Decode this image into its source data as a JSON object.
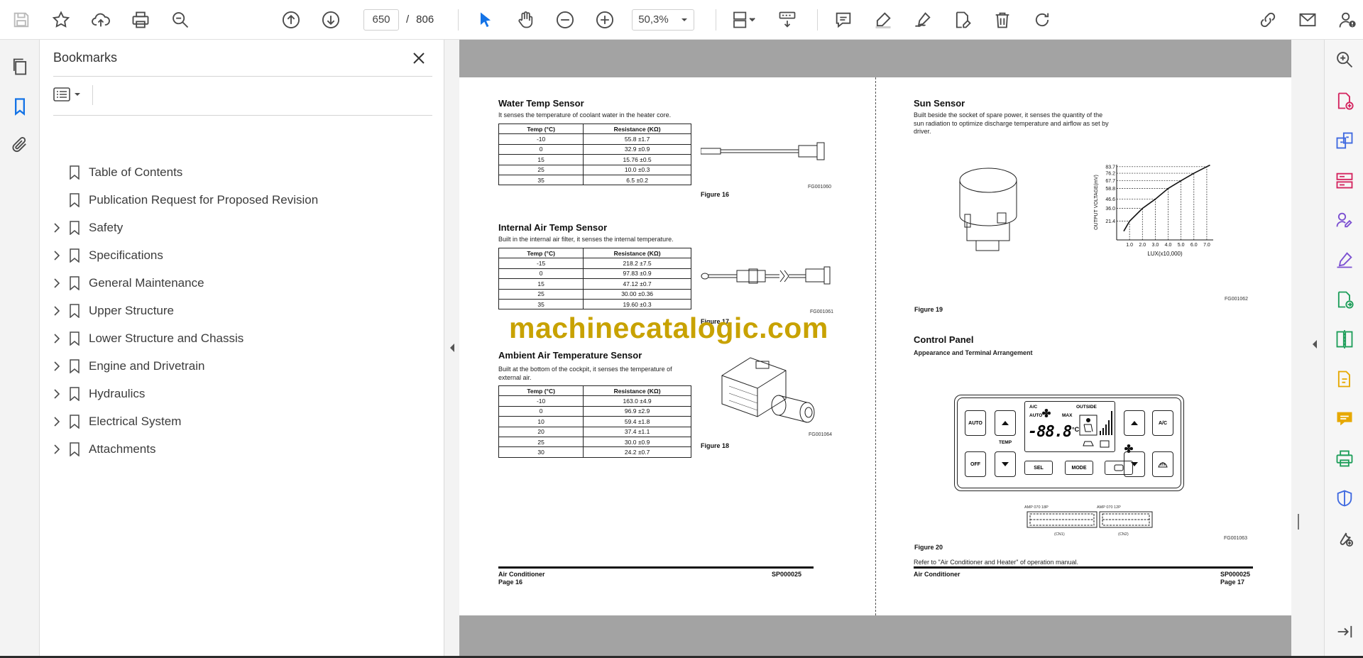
{
  "toolbar": {
    "page_current": "650",
    "page_separator": "/",
    "page_total": "806",
    "zoom": "50,3%"
  },
  "bookmarks": {
    "title": "Bookmarks",
    "items": [
      {
        "label": "Table of Contents",
        "expandable": false
      },
      {
        "label": "Publication Request for Proposed Revision",
        "expandable": false
      },
      {
        "label": "Safety",
        "expandable": true
      },
      {
        "label": "Specifications",
        "expandable": true
      },
      {
        "label": "General Maintenance",
        "expandable": true
      },
      {
        "label": "Upper Structure",
        "expandable": true
      },
      {
        "label": "Lower Structure and Chassis",
        "expandable": true
      },
      {
        "label": "Engine and Drivetrain",
        "expandable": true
      },
      {
        "label": "Hydraulics",
        "expandable": true
      },
      {
        "label": "Electrical System",
        "expandable": true
      },
      {
        "label": "Attachments",
        "expandable": true
      }
    ]
  },
  "colors": {
    "accent": "#1473e6",
    "icon": "#4b4b4b",
    "tool_pink": "#d4245f",
    "tool_blue": "#3f69e0",
    "tool_purple": "#7b4fd1",
    "tool_green": "#1e9e5a",
    "tool_yellow": "#e6a800",
    "watermark": "#c8a200"
  },
  "page16": {
    "water": {
      "heading": "Water Temp Sensor",
      "desc": "It senses the temperature of coolant water in the heater core.",
      "col1": "Temp (°C)",
      "col2": "Resistance (KΩ)",
      "rows": [
        [
          "-10",
          "55.8 ±1.7"
        ],
        [
          "0",
          "32.9 ±0.9"
        ],
        [
          "15",
          "15.76 ±0.5"
        ],
        [
          "25",
          "10.0 ±0.3"
        ],
        [
          "35",
          "6.5 ±0.2"
        ]
      ],
      "code": "FG001060",
      "figure": "Figure 16"
    },
    "internal": {
      "heading": "Internal Air Temp Sensor",
      "desc": "Built in the internal air filter, it senses the internal temperature.",
      "col1": "Temp (°C)",
      "col2": "Resistance (KΩ)",
      "rows": [
        [
          "-15",
          "218.2 ±7.5"
        ],
        [
          "0",
          "97.83 ±0.9"
        ],
        [
          "15",
          "47.12 ±0.7"
        ],
        [
          "25",
          "30.00 ±0.36"
        ],
        [
          "35",
          "19.60 ±0.3"
        ]
      ],
      "code": "FG001061",
      "figure": "Figure 17"
    },
    "ambient": {
      "heading": "Ambient Air Temperature Sensor",
      "desc": "Built at the bottom of the cockpit, it senses the temperature of external air.",
      "col1": "Temp (°C)",
      "col2": "Resistance (KΩ)",
      "rows": [
        [
          "-10",
          "163.0 ±4.9"
        ],
        [
          "0",
          "96.9 ±2.9"
        ],
        [
          "10",
          "59.4 ±1.8"
        ],
        [
          "20",
          "37.4 ±1.1"
        ],
        [
          "25",
          "30.0 ±0.9"
        ],
        [
          "30",
          "24.2 ±0.7"
        ]
      ],
      "code": "FG001064",
      "figure": "Figure 18"
    },
    "footer_left": "Air Conditioner",
    "footer_page": "Page 16",
    "footer_right": "SP000025"
  },
  "page17": {
    "sun": {
      "heading": "Sun Sensor",
      "desc": "Built beside the socket of spare power, it senses the quantity of the sun radiation to optimize discharge temperature and airflow as set by driver.",
      "figure": "Figure 19",
      "code": "FG001062"
    },
    "control": {
      "heading": "Control Panel",
      "subheading": "Appearance and Terminal Arrangement",
      "figure": "Figure 20",
      "code": "FG001063",
      "note": "Refer to \"Air Conditioner and Heater\" of operation manual.",
      "panel": {
        "auto_btn": "AUTO",
        "off_btn": "OFF",
        "ac_btn": "A/C",
        "temp_label": "TEMP",
        "sel_btn": "SEL",
        "mode_btn": "MODE",
        "lcd_ac": "A/C",
        "lcd_auto": "AUTO",
        "lcd_max": "MAX",
        "lcd_outside": "OUTSIDE",
        "lcd_digits": "-88.8",
        "lcd_unit": "°C"
      },
      "connector1": "AMP 070 18P",
      "connector2": "AMP 070 12P",
      "cn1": "(CN1)",
      "cn2": "(CN2)"
    },
    "footer_left": "Air Conditioner",
    "footer_page": "Page 17",
    "footer_right": "SP000025"
  },
  "watermark": "machinecatalogic.com",
  "chart_data": {
    "type": "line",
    "title": "",
    "xlabel": "LUX(x10,000)",
    "ylabel": "OUTPUT VOLTAGE(mV)",
    "x": [
      1.0,
      2.0,
      3.0,
      4.0,
      5.0,
      6.0,
      7.0
    ],
    "x_ticks": [
      "1.0",
      "2.0",
      "3.0",
      "4.0",
      "5.0",
      "6.0",
      "7.0"
    ],
    "y_ticks": [
      "21.4",
      "36.0",
      "46.6",
      "58.8",
      "67.7",
      "76.2",
      "83.7"
    ],
    "series": [
      {
        "values": [
          21.4,
          36.0,
          46.6,
          58.8,
          67.7,
          76.2,
          83.7
        ]
      }
    ],
    "xlim": [
      0,
      7.5
    ],
    "ylim": [
      0,
      86
    ],
    "grid": "dashed-guides"
  }
}
